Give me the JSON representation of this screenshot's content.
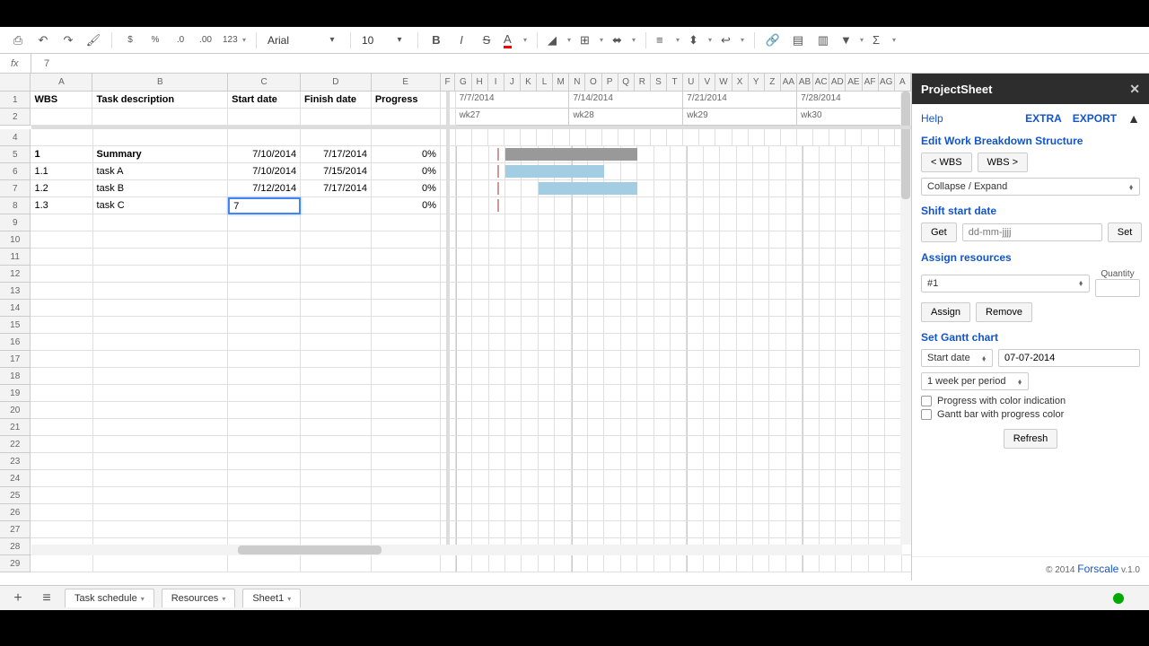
{
  "toolbar": {
    "font": "Arial",
    "size": "10",
    "numformat": "123"
  },
  "fx": {
    "label": "fx",
    "value": "7"
  },
  "columns": {
    "named": [
      {
        "id": "A",
        "w": 70
      },
      {
        "id": "B",
        "w": 153
      },
      {
        "id": "C",
        "w": 82
      },
      {
        "id": "D",
        "w": 80
      },
      {
        "id": "E",
        "w": 78
      },
      {
        "id": "F",
        "w": 17
      }
    ],
    "gantt": [
      "G",
      "H",
      "I",
      "J",
      "K",
      "L",
      "M",
      "N",
      "O",
      "P",
      "Q",
      "R",
      "S",
      "T",
      "U",
      "V",
      "W",
      "X",
      "Y",
      "Z",
      "AA",
      "AB",
      "AC",
      "AD",
      "AE",
      "AF",
      "AG",
      "A"
    ],
    "gw": 18.4
  },
  "headers": {
    "A": "WBS",
    "B": "Task description",
    "C": "Start date",
    "D": "Finish date",
    "E": "Progress"
  },
  "gantt_periods": [
    {
      "date": "7/7/2014",
      "wk": "wk27"
    },
    {
      "date": "7/14/2014",
      "wk": "wk28"
    },
    {
      "date": "7/21/2014",
      "wk": "wk29"
    },
    {
      "date": "7/28/2014",
      "wk": "wk30"
    }
  ],
  "rows": [
    {
      "n": 5,
      "wbs": "1",
      "task": "Summary",
      "bold": true,
      "start": "7/10/2014",
      "finish": "7/17/2014",
      "prog": "0%",
      "bar": {
        "l": 3,
        "w": 8,
        "cls": "gray"
      }
    },
    {
      "n": 6,
      "wbs": "1.1",
      "task": "task A",
      "start": "7/10/2014",
      "finish": "7/15/2014",
      "prog": "0%",
      "bar": {
        "l": 3,
        "w": 6,
        "cls": "blue"
      }
    },
    {
      "n": 7,
      "wbs": "1.2",
      "task": "task B",
      "start": "7/12/2014",
      "finish": "7/17/2014",
      "prog": "0%",
      "bar": {
        "l": 5,
        "w": 6,
        "cls": "blue"
      }
    },
    {
      "n": 8,
      "wbs": "1.3",
      "task": "task C",
      "start": "",
      "finish": "",
      "prog": "0%",
      "editing": true,
      "editval": "7"
    }
  ],
  "panel": {
    "title": "ProjectSheet",
    "help": "Help",
    "extra": "EXTRA",
    "export": "EXPORT",
    "edit_wbs": "Edit Work Breakdown Structure",
    "wbs_left": "< WBS",
    "wbs_right": "WBS >",
    "collapse": "Collapse / Expand",
    "shift": "Shift start date",
    "get": "Get",
    "date_ph": "dd-mm-jjjj",
    "set": "Set",
    "assign": "Assign resources",
    "qty": "Quantity",
    "res_sel": "#1",
    "assign_btn": "Assign",
    "remove": "Remove",
    "setgantt": "Set Gantt chart",
    "startdate_lbl": "Start date",
    "startdate_val": "07-07-2014",
    "period_sel": "1 week per period",
    "opt1": "Progress with color indication",
    "opt2": "Gantt bar with progress color",
    "refresh": "Refresh",
    "foot_pre": "© 2014 ",
    "foot_link": "Forscale",
    "foot_post": " v.1.0"
  },
  "tabs": {
    "t1": "Task schedule",
    "t2": "Resources",
    "t3": "Sheet1"
  }
}
